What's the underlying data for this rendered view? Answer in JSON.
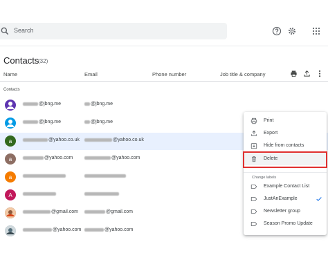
{
  "search": {
    "placeholder": "Search"
  },
  "page": {
    "title": "Contacts",
    "count": "(32)"
  },
  "columns": {
    "name": "Name",
    "email": "Email",
    "phone": "Phone number",
    "job": "Job title & company"
  },
  "section_label": "Contacts",
  "rows": [
    {
      "avatar_letter": "",
      "avatar_color": "#5e35b1",
      "name_suffix": "@jbng.me",
      "email_suffix": "@jbng.me",
      "selected": false
    },
    {
      "avatar_letter": "",
      "avatar_color": "#039be5",
      "name_suffix": "@jbng.me",
      "email_suffix": "@jbng.me",
      "selected": false
    },
    {
      "avatar_letter": "a",
      "avatar_color": "#33691e",
      "name_suffix": "@yahoo.co.uk",
      "email_suffix": "@yahoo.co.uk",
      "selected": true
    },
    {
      "avatar_letter": "a",
      "avatar_color": "#8d6e63",
      "name_suffix": "@yahoo.com",
      "email_suffix": "@yahoo.com",
      "selected": false
    },
    {
      "avatar_letter": "a",
      "avatar_color": "#f57c00",
      "name_suffix": "",
      "email_suffix": "",
      "selected": false
    },
    {
      "avatar_letter": "A",
      "avatar_color": "#c2185b",
      "name_suffix": "",
      "email_suffix": "",
      "selected": false
    },
    {
      "avatar_letter": "",
      "avatar_color": "#6d4c41",
      "name_suffix": "@gmail.com",
      "email_suffix": "@gmail.com",
      "selected": false
    },
    {
      "avatar_letter": "",
      "avatar_color": "#90a4ae",
      "name_suffix": "@yahoo.com",
      "email_suffix": "@yahoo.com",
      "selected": false
    }
  ],
  "menu": {
    "items": [
      {
        "label": "Print",
        "icon": "print-icon"
      },
      {
        "label": "Export",
        "icon": "export-icon"
      },
      {
        "label": "Hide from contacts",
        "icon": "hide-icon"
      },
      {
        "label": "Delete",
        "icon": "trash-icon"
      }
    ],
    "section_label": "Change labels",
    "labels": [
      {
        "label": "Example Contact List",
        "checked": false
      },
      {
        "label": "JustAnExample",
        "checked": true
      },
      {
        "label": "Newsletter group",
        "checked": false
      },
      {
        "label": "Season Promo Update",
        "checked": false
      }
    ]
  },
  "colors": {
    "highlight": "#e0302f",
    "accent": "#1a73e8",
    "selected_row": "#e8f0fe"
  }
}
